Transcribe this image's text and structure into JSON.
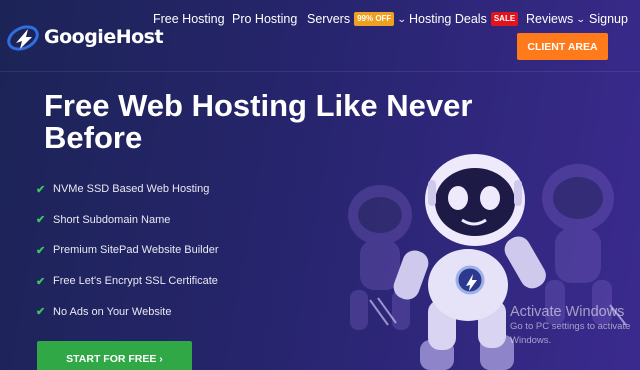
{
  "brand": {
    "name": "GoogieHost",
    "logo_icon": "gh-swoosh-logo"
  },
  "nav": {
    "items": [
      {
        "label": "Free Hosting"
      },
      {
        "label": "Pro Hosting"
      },
      {
        "label": "Servers",
        "badge": "99% OFF",
        "dropdown": true
      },
      {
        "label": "Hosting Deals",
        "badge": "SALE"
      },
      {
        "label": "Reviews",
        "dropdown": true
      },
      {
        "label": "Signup"
      }
    ],
    "client_area": "CLIENT AREA"
  },
  "hero": {
    "title": "Free Web Hosting Like Never Before",
    "features": [
      "NVMe SSD Based Web Hosting",
      "Short Subdomain Name",
      "Premium SitePad Website Builder",
      "Free Let's Encrypt SSL Certificate",
      "No Ads on Your Website"
    ],
    "cta": "START FOR FREE ›"
  },
  "watermark": {
    "title": "Activate Windows",
    "subtitle": "Go to PC settings to activate Windows."
  },
  "colors": {
    "accent_orange": "#ff7a1a",
    "cta_green": "#2fa845",
    "check_green": "#3fc45a",
    "badge_orange": "#f0a020",
    "badge_red": "#e0141e"
  }
}
